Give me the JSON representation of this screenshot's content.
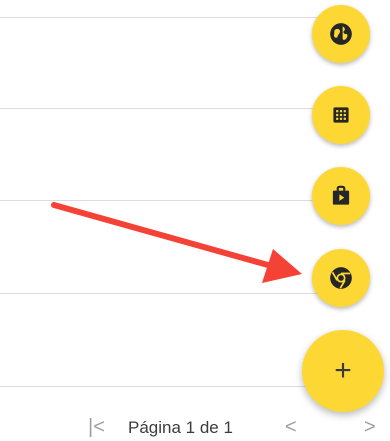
{
  "fab_actions": [
    {
      "name": "globe",
      "icon": "globe-icon"
    },
    {
      "name": "dialpad",
      "icon": "dialpad-icon"
    },
    {
      "name": "play-store",
      "icon": "play-store-icon"
    },
    {
      "name": "chrome",
      "icon": "chrome-icon"
    }
  ],
  "main_fab": {
    "label": "+",
    "icon": "plus-icon"
  },
  "pagination": {
    "first_label": "|<",
    "page_label": "Página 1 de 1",
    "prev_label": "<",
    "next_label": ">"
  },
  "annotation": {
    "color": "#f44336"
  },
  "colors": {
    "fab": "#fdd835",
    "divider": "#dcdcdc"
  }
}
